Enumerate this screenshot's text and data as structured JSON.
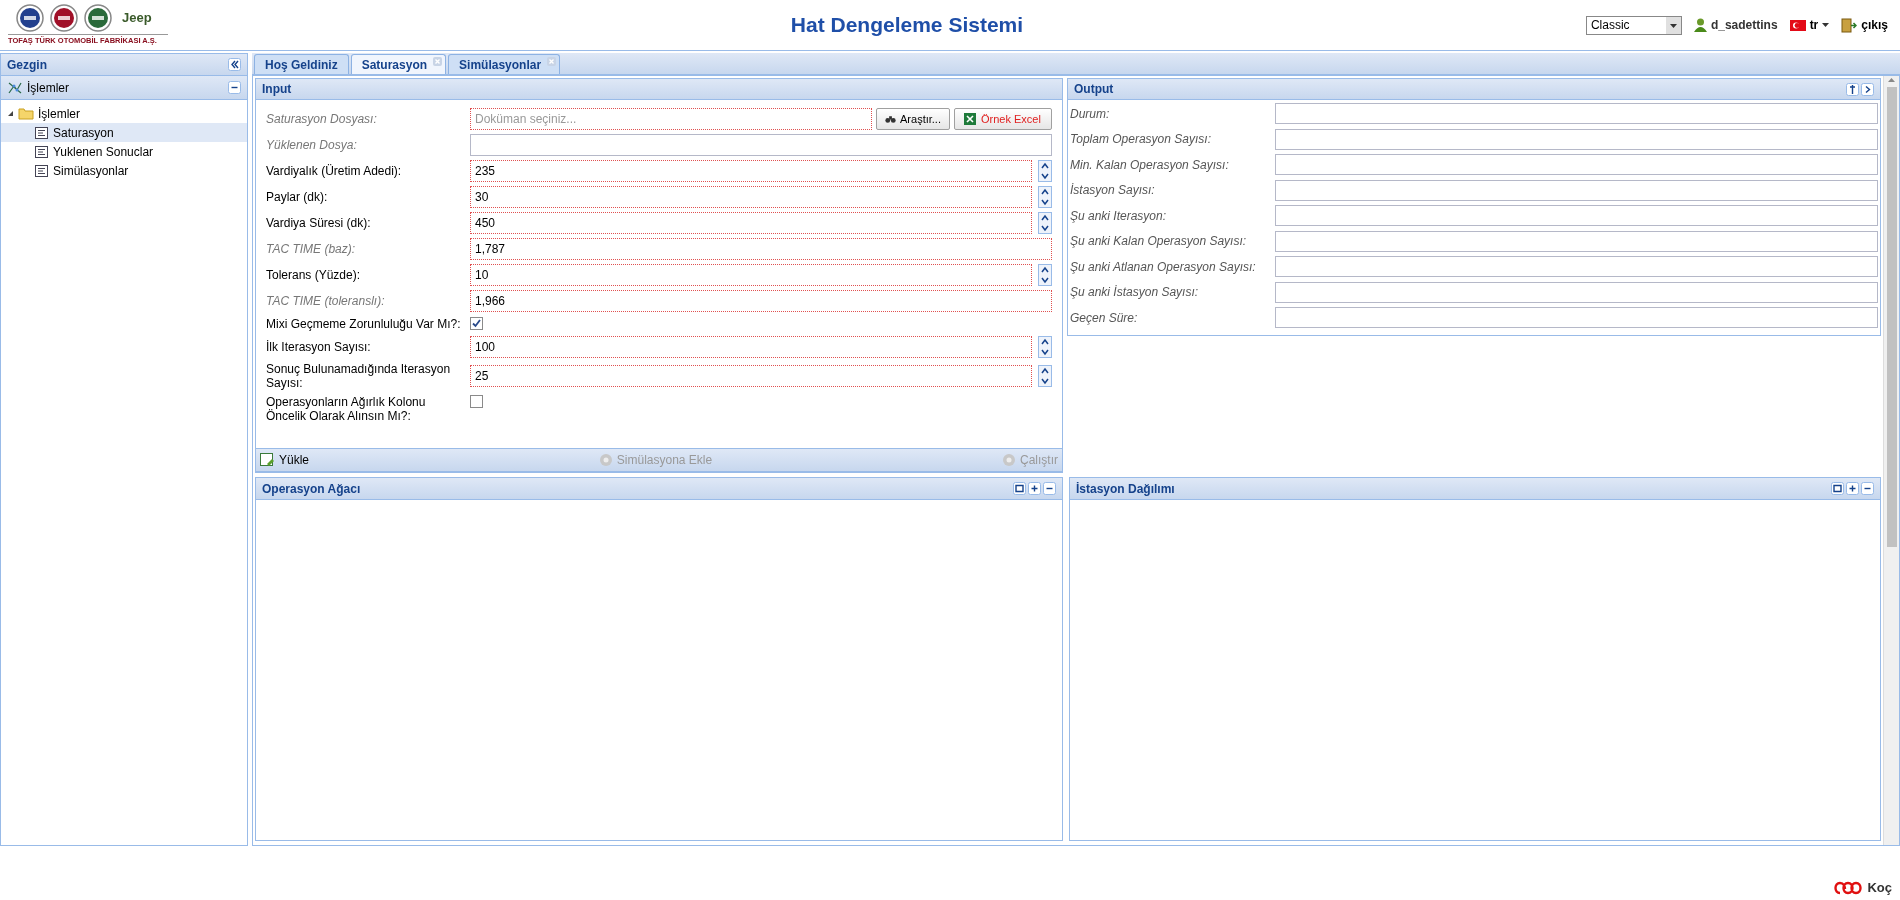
{
  "header": {
    "brand": "Jeep",
    "company": "TOFAŞ TÜRK OTOMOBİL FABRİKASI A.Ş.",
    "title": "Hat Dengeleme Sistemi",
    "theme_select": "Classic",
    "user": "d_sadettins",
    "language": "tr",
    "logout": "çıkış"
  },
  "sidebar": {
    "title": "Gezgin",
    "section": "İşlemler",
    "tree": [
      {
        "label": "İşlemler",
        "expanded": true,
        "children": [
          {
            "label": "Saturasyon",
            "selected": true
          },
          {
            "label": "Yuklenen Sonuclar",
            "selected": false
          },
          {
            "label": "Simülasyonlar",
            "selected": false
          }
        ]
      }
    ]
  },
  "tabs": [
    {
      "label": "Hoş Geldiniz",
      "selected": false,
      "closable": false
    },
    {
      "label": "Saturasyon",
      "selected": true,
      "closable": true
    },
    {
      "label": "Simülasyonlar",
      "selected": false,
      "closable": true
    }
  ],
  "input": {
    "title": "Input",
    "fields": [
      {
        "kind": "file",
        "label": "Saturasyon Dosyası:",
        "readonly": true,
        "invalid": true,
        "placeholder": "Doküman seçiniz...",
        "buttons": [
          "Araştır...",
          "Örnek Excel"
        ]
      },
      {
        "kind": "text",
        "label": "Yüklenen Dosya:",
        "readonly": true,
        "invalid": false
      },
      {
        "kind": "number",
        "label": "Vardiyalık (Üretim Adedi):",
        "readonly": false,
        "invalid": true,
        "value": "235"
      },
      {
        "kind": "number",
        "label": "Paylar (dk):",
        "readonly": false,
        "invalid": true,
        "value": "30"
      },
      {
        "kind": "number",
        "label": "Vardiya Süresi (dk):",
        "readonly": false,
        "invalid": true,
        "value": "450"
      },
      {
        "kind": "text",
        "label": "TAC TIME (baz):",
        "readonly": true,
        "invalid": true,
        "value": "1,787"
      },
      {
        "kind": "number",
        "label": "Tolerans (Yüzde):",
        "readonly": false,
        "invalid": true,
        "value": "10"
      },
      {
        "kind": "text",
        "label": "TAC TIME (toleranslı):",
        "readonly": true,
        "invalid": true,
        "value": "1,966"
      },
      {
        "kind": "checkbox",
        "label": "Mixi Geçmeme Zorunluluğu Var Mı?:",
        "checked": true
      },
      {
        "kind": "number",
        "label": "İlk Iterasyon Sayısı:",
        "readonly": false,
        "invalid": true,
        "value": "100"
      },
      {
        "kind": "number",
        "label": "Sonuç Bulunamadığında Iterasyon Sayısı:",
        "readonly": false,
        "invalid": true,
        "value": "25"
      },
      {
        "kind": "checkbox",
        "label": "Operasyonların Ağırlık Kolonu Öncelik Olarak Alınsın Mı?:",
        "checked": false
      }
    ],
    "toolbar": [
      {
        "label": "Yükle",
        "disabled": false
      },
      {
        "label": "Simülasyona Ekle",
        "disabled": true
      },
      {
        "label": "Çalıştır",
        "disabled": true
      }
    ]
  },
  "output": {
    "title": "Output",
    "fields": [
      "Durum:",
      "Toplam Operasyon Sayısı:",
      "Min. Kalan Operasyon Sayısı:",
      "İstasyon Sayısı:",
      "Şu anki Iterasyon:",
      "Şu anki Kalan Operasyon Sayısı:",
      "Şu anki Atlanan Operasyon Sayısı:",
      "Şu anki İstasyon Sayısı:",
      "Geçen Süre:"
    ]
  },
  "lower_panels": [
    {
      "title": "Operasyon Ağacı"
    },
    {
      "title": "İstasyon Dağılımı"
    }
  ],
  "footer": {
    "brand": "Koç"
  }
}
